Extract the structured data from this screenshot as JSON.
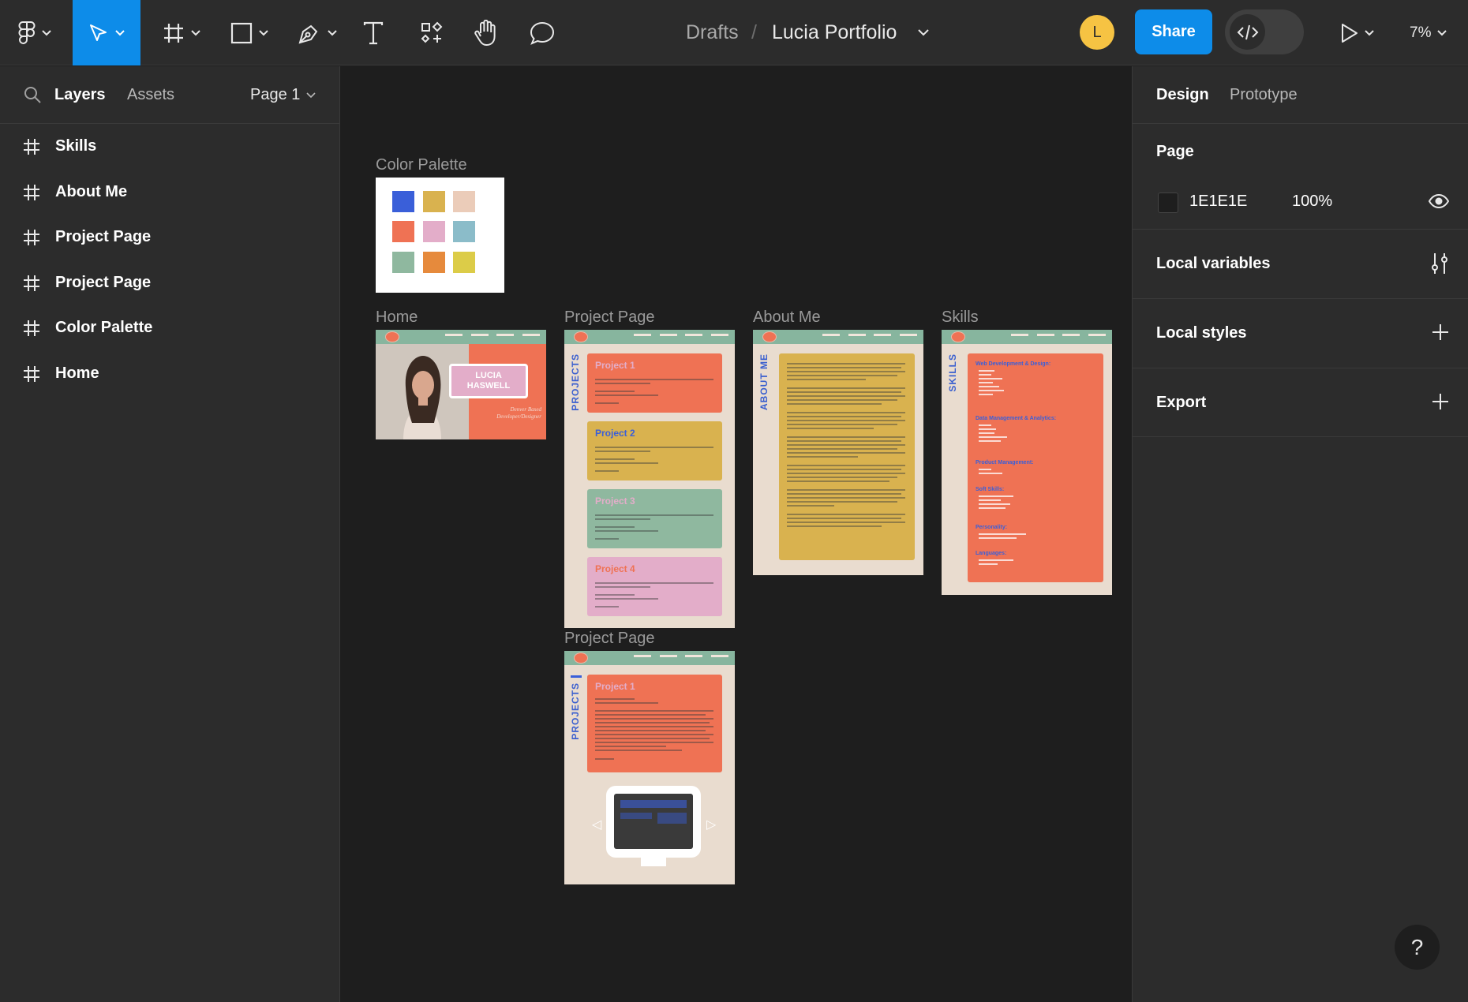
{
  "toolbar": {
    "tools": [
      {
        "name": "main-menu",
        "icon": "figma-logo-icon"
      },
      {
        "name": "move",
        "icon": "cursor-arrow-icon",
        "active": true
      },
      {
        "name": "frame",
        "icon": "frame-hash-icon"
      },
      {
        "name": "shape",
        "icon": "rectangle-icon"
      },
      {
        "name": "pen",
        "icon": "pen-icon"
      },
      {
        "name": "text",
        "icon": "text-icon"
      },
      {
        "name": "resources",
        "icon": "components-icon"
      },
      {
        "name": "hand",
        "icon": "hand-icon"
      },
      {
        "name": "comment",
        "icon": "comment-icon"
      }
    ],
    "breadcrumb": {
      "project": "Drafts",
      "separator": "/",
      "file": "Lucia Portfolio"
    },
    "avatar_initial": "L",
    "share_label": "Share",
    "zoom": "7%"
  },
  "left_panel": {
    "tabs": {
      "layers": "Layers",
      "assets": "Assets"
    },
    "page_selector": "Page 1",
    "layers": [
      "Skills",
      "About Me",
      "Project Page",
      "Project Page",
      "Color Palette",
      "Home"
    ]
  },
  "right_panel": {
    "tabs": {
      "design": "Design",
      "prototype": "Prototype"
    },
    "page_section": {
      "title": "Page",
      "fill_hex": "1E1E1E",
      "opacity": "100%"
    },
    "local_variables": "Local variables",
    "local_styles": "Local styles",
    "export": "Export",
    "help": "?"
  },
  "canvas": {
    "frames": {
      "color_palette": "Color Palette",
      "home": "Home",
      "project_page": "Project Page",
      "about_me": "About Me",
      "skills": "Skills",
      "project_page_2": "Project Page"
    },
    "palette_colors": [
      "#3a5fd9",
      "#d9b24f",
      "#ebccb9",
      "#ef7254",
      "#e3adc9",
      "#8bbcc9",
      "#8fb89f",
      "#e68a3c",
      "#dccc48"
    ],
    "home": {
      "name": "LUCIA HASWELL",
      "tagline": "Denver Based Developer/Designer"
    },
    "project_titles": [
      "Project 1",
      "Project 2",
      "Project 3",
      "Project 4"
    ],
    "project_sidebar": "PROJECTS",
    "about_sidebar": "ABOUT ME",
    "skills_sidebar": "SKILLS",
    "skills_headings": [
      "Web Development & Design:",
      "Data Management & Analytics:",
      "Product Management:",
      "Soft Skills:",
      "Personality:",
      "Languages:"
    ],
    "project_detail_title": "Project 1"
  }
}
